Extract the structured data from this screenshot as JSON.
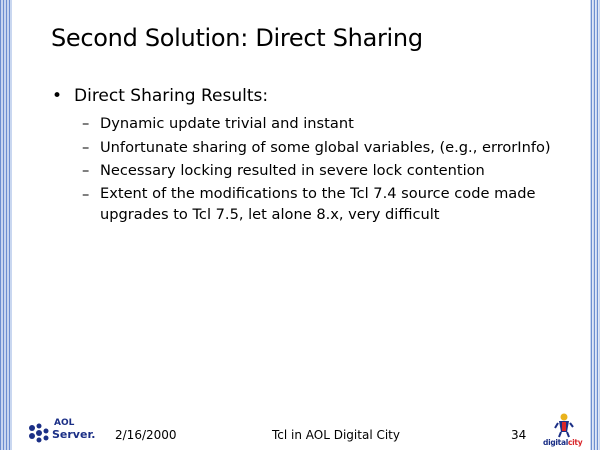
{
  "slide": {
    "title": "Second Solution:  Direct Sharing",
    "bullet": "Direct Sharing Results:",
    "bullet_marker": "•",
    "sub_marker": "–",
    "sub_items": [
      "Dynamic update trivial and instant",
      "Unfortunate sharing of some global variables, (e.g., errorInfo)",
      "Necessary locking resulted in severe lock contention",
      "Extent of the modifications to the Tcl 7.4 source code made upgrades to Tcl 7.5, let alone 8.x, very difficult"
    ]
  },
  "footer": {
    "date": "2/16/2000",
    "center": "Tcl in AOL Digital City",
    "page": "34"
  },
  "logos": {
    "left_brand_top": "AOL",
    "left_brand_bottom": "Server.",
    "right_brand_part1": "digital",
    "right_brand_part2": "city",
    "left_icon": "aolserver-dots-icon",
    "right_icon": "digitalcity-figure-icon"
  },
  "colors": {
    "border_dark": "#6d8fd0",
    "border_light": "#c9d7f0",
    "brand_blue": "#1b2f86",
    "brand_red": "#d9262a"
  }
}
